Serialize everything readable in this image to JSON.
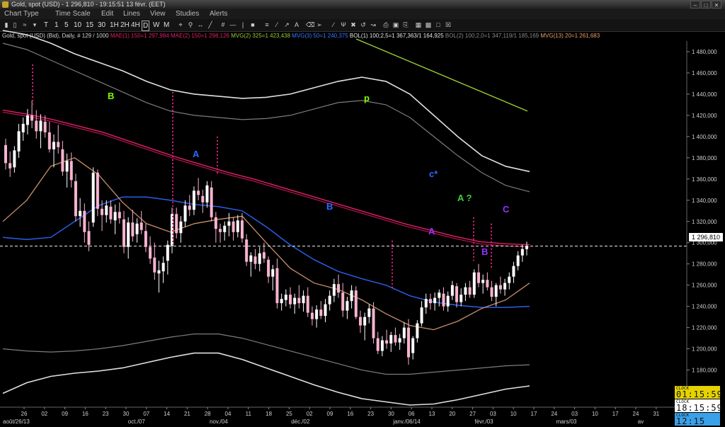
{
  "window": {
    "title": "Gold, spot (USD) - 1 296,810 - 19:15:51  13 févr. (EET)"
  },
  "menu": [
    "Chart Type",
    "Time Scale",
    "Edit",
    "Lines",
    "View",
    "Studies",
    "Alerts"
  ],
  "toolbar": {
    "timescales": [
      "T",
      "1",
      "5",
      "10",
      "15",
      "30",
      "1H",
      "2H",
      "4H",
      "D",
      "W",
      "M"
    ],
    "selected": "D"
  },
  "legend": [
    {
      "text": "Gold, spot (USD) (Bid), Daily, # 129 / 1000",
      "color": "#d8d8d8"
    },
    {
      "text": "MAE(1) 150=1 297,984",
      "color": "#e0206a"
    },
    {
      "text": "MAE(2) 150=1 298,126",
      "color": "#e0206a"
    },
    {
      "text": "MVG(2) 325=1 423,438",
      "color": "#9acd32"
    },
    {
      "text": "MVG(3) 50=1 240,375",
      "color": "#3a78ff"
    },
    {
      "text": "BOL(1) 100;2,5=1 367,363/1 164,925",
      "color": "#e8e8e8"
    },
    {
      "text": "BOL(2) 100;2,0=1 347,119/1 185,169",
      "color": "#8a8a8a"
    },
    {
      "text": "MVG(13) 20=1 261,683",
      "color": "#e8a060"
    }
  ],
  "annotations": [
    {
      "text": "B",
      "color": "#7fff00"
    },
    {
      "text": "p",
      "color": "#7fff00"
    },
    {
      "text": "A",
      "color": "#2a6aff"
    },
    {
      "text": "c*",
      "color": "#2a6aff"
    },
    {
      "text": "A ?",
      "color": "#3ed13e"
    },
    {
      "text": "B",
      "color": "#2a6aff"
    },
    {
      "text": "C",
      "color": "#9b30ff"
    },
    {
      "text": "A",
      "color": "#9b30ff"
    },
    {
      "text": "B",
      "color": "#9b30ff"
    }
  ],
  "price_label": "1 296,810",
  "clocks": [
    {
      "label": "CLOCK",
      "value": "01:15:59"
    },
    {
      "label": "CLOCK",
      "value": "18:15:59"
    },
    {
      "label": "CLOCK",
      "value": "12:15"
    }
  ],
  "chart_data": {
    "type": "candlestick",
    "title": "Gold, spot (USD) (Bid), Daily",
    "y_ticks": [
      1160,
      1180,
      1200,
      1220,
      1240,
      1260,
      1280,
      1300,
      1320,
      1340,
      1360,
      1380,
      1400,
      1420,
      1440,
      1460,
      1480
    ],
    "y_tick_labels": [
      "1 160,000",
      "1 180,000",
      "1 200,000",
      "1 220,000",
      "1 240,000",
      "1 260,000",
      "1 280,000",
      "1 300,000",
      "1 320,000",
      "1 340,000",
      "1 360,000",
      "1 380,000",
      "1 400,000",
      "1 420,000",
      "1 440,000",
      "1 460,000",
      "1 480,000"
    ],
    "last_price": 1296.81,
    "x_ticks": [
      "26",
      "02",
      "09",
      "16",
      "23",
      "30",
      "07",
      "14",
      "21",
      "28",
      "04",
      "11",
      "18",
      "25",
      "02",
      "09",
      "16",
      "23",
      "30",
      "06",
      "13",
      "20",
      "27",
      "03",
      "10",
      "17",
      "24",
      "03",
      "10",
      "17",
      "24",
      "31"
    ],
    "x_month_labels": [
      "août/26/13",
      "oct./07",
      "nov./04",
      "déc./02",
      "janv./06/14",
      "févr./03",
      "mars/03",
      "av"
    ],
    "candles": [
      [
        1392,
        1398,
        1369,
        1375
      ],
      [
        1375,
        1386,
        1362,
        1370
      ],
      [
        1371,
        1391,
        1366,
        1387
      ],
      [
        1386,
        1412,
        1380,
        1405
      ],
      [
        1404,
        1418,
        1396,
        1412
      ],
      [
        1411,
        1426,
        1402,
        1420
      ],
      [
        1420,
        1434,
        1408,
        1415
      ],
      [
        1415,
        1425,
        1398,
        1405
      ],
      [
        1405,
        1421,
        1389,
        1415
      ],
      [
        1414,
        1420,
        1399,
        1404
      ],
      [
        1404,
        1414,
        1385,
        1388
      ],
      [
        1388,
        1402,
        1371,
        1395
      ],
      [
        1395,
        1411,
        1384,
        1390
      ],
      [
        1388,
        1396,
        1363,
        1367
      ],
      [
        1367,
        1384,
        1352,
        1377
      ],
      [
        1377,
        1385,
        1352,
        1359
      ],
      [
        1358,
        1365,
        1320,
        1325
      ],
      [
        1325,
        1342,
        1315,
        1330
      ],
      [
        1330,
        1337,
        1300,
        1310
      ],
      [
        1311,
        1320,
        1292,
        1298
      ],
      [
        1319,
        1371,
        1315,
        1366
      ],
      [
        1366,
        1369,
        1325,
        1332
      ],
      [
        1332,
        1340,
        1311,
        1326
      ],
      [
        1326,
        1340,
        1319,
        1335
      ],
      [
        1334,
        1340,
        1318,
        1322
      ],
      [
        1321,
        1336,
        1308,
        1329
      ],
      [
        1329,
        1338,
        1318,
        1323
      ],
      [
        1322,
        1330,
        1290,
        1296
      ],
      [
        1296,
        1324,
        1285,
        1319
      ],
      [
        1319,
        1331,
        1301,
        1306
      ],
      [
        1308,
        1323,
        1300,
        1318
      ],
      [
        1319,
        1330,
        1308,
        1312
      ],
      [
        1311,
        1318,
        1291,
        1296
      ],
      [
        1296,
        1306,
        1280,
        1285
      ],
      [
        1286,
        1300,
        1265,
        1272
      ],
      [
        1271,
        1283,
        1253,
        1274
      ],
      [
        1273,
        1287,
        1262,
        1281
      ],
      [
        1283,
        1302,
        1270,
        1298
      ],
      [
        1297,
        1333,
        1290,
        1327
      ],
      [
        1327,
        1333,
        1304,
        1309
      ],
      [
        1309,
        1325,
        1300,
        1320
      ],
      [
        1320,
        1340,
        1315,
        1335
      ],
      [
        1335,
        1345,
        1325,
        1331
      ],
      [
        1331,
        1353,
        1326,
        1349
      ],
      [
        1349,
        1361,
        1340,
        1345
      ],
      [
        1344,
        1350,
        1328,
        1338
      ],
      [
        1338,
        1358,
        1333,
        1354
      ],
      [
        1352,
        1358,
        1320,
        1324
      ],
      [
        1324,
        1329,
        1300,
        1313
      ],
      [
        1313,
        1318,
        1300,
        1310
      ],
      [
        1310,
        1320,
        1302,
        1316
      ],
      [
        1316,
        1328,
        1306,
        1320
      ],
      [
        1320,
        1324,
        1302,
        1310
      ],
      [
        1310,
        1326,
        1305,
        1321
      ],
      [
        1321,
        1328,
        1300,
        1304
      ],
      [
        1303,
        1308,
        1278,
        1282
      ],
      [
        1282,
        1291,
        1268,
        1288
      ],
      [
        1287,
        1294,
        1275,
        1280
      ],
      [
        1280,
        1296,
        1273,
        1290
      ],
      [
        1291,
        1300,
        1281,
        1285
      ],
      [
        1284,
        1287,
        1262,
        1268
      ],
      [
        1268,
        1279,
        1255,
        1275
      ],
      [
        1276,
        1285,
        1238,
        1243
      ],
      [
        1243,
        1252,
        1236,
        1247
      ],
      [
        1246,
        1256,
        1240,
        1251
      ],
      [
        1251,
        1258,
        1238,
        1242
      ],
      [
        1242,
        1252,
        1233,
        1248
      ],
      [
        1248,
        1260,
        1238,
        1243
      ],
      [
        1243,
        1255,
        1235,
        1250
      ],
      [
        1250,
        1258,
        1230,
        1234
      ],
      [
        1234,
        1240,
        1222,
        1228
      ],
      [
        1228,
        1241,
        1220,
        1237
      ],
      [
        1237,
        1245,
        1228,
        1231
      ],
      [
        1231,
        1247,
        1225,
        1242
      ],
      [
        1242,
        1255,
        1236,
        1250
      ],
      [
        1250,
        1266,
        1244,
        1261
      ],
      [
        1261,
        1270,
        1248,
        1253
      ],
      [
        1253,
        1262,
        1230,
        1236
      ],
      [
        1236,
        1249,
        1228,
        1245
      ],
      [
        1245,
        1260,
        1238,
        1255
      ],
      [
        1255,
        1259,
        1228,
        1230
      ],
      [
        1230,
        1236,
        1215,
        1222
      ],
      [
        1222,
        1234,
        1208,
        1230
      ],
      [
        1230,
        1242,
        1224,
        1238
      ],
      [
        1238,
        1244,
        1205,
        1210
      ],
      [
        1210,
        1216,
        1195,
        1198
      ],
      [
        1198,
        1212,
        1193,
        1208
      ],
      [
        1208,
        1218,
        1200,
        1205
      ],
      [
        1205,
        1216,
        1197,
        1213
      ],
      [
        1213,
        1220,
        1203,
        1206
      ],
      [
        1206,
        1214,
        1199,
        1210
      ],
      [
        1210,
        1225,
        1205,
        1220
      ],
      [
        1220,
        1228,
        1185,
        1192
      ],
      [
        1196,
        1212,
        1190,
        1210
      ],
      [
        1210,
        1227,
        1206,
        1224
      ],
      [
        1224,
        1245,
        1221,
        1239
      ],
      [
        1239,
        1252,
        1233,
        1247
      ],
      [
        1247,
        1252,
        1237,
        1243
      ],
      [
        1243,
        1253,
        1236,
        1248
      ],
      [
        1248,
        1256,
        1240,
        1253
      ],
      [
        1252,
        1258,
        1236,
        1240
      ],
      [
        1240,
        1254,
        1235,
        1250
      ],
      [
        1250,
        1264,
        1246,
        1260
      ],
      [
        1259,
        1262,
        1239,
        1244
      ],
      [
        1244,
        1257,
        1240,
        1251
      ],
      [
        1251,
        1262,
        1245,
        1258
      ],
      [
        1258,
        1264,
        1248,
        1251
      ],
      [
        1251,
        1275,
        1248,
        1272
      ],
      [
        1272,
        1280,
        1258,
        1262
      ],
      [
        1262,
        1270,
        1252,
        1265
      ],
      [
        1265,
        1272,
        1255,
        1258
      ],
      [
        1258,
        1264,
        1245,
        1249
      ],
      [
        1249,
        1262,
        1240,
        1260
      ],
      [
        1260,
        1268,
        1252,
        1256
      ],
      [
        1256,
        1266,
        1250,
        1262
      ],
      [
        1262,
        1272,
        1256,
        1268
      ],
      [
        1268,
        1282,
        1262,
        1278
      ],
      [
        1278,
        1292,
        1274,
        1288
      ],
      [
        1288,
        1298,
        1282,
        1294
      ],
      [
        1294,
        1301,
        1288,
        1297
      ]
    ],
    "series": [
      {
        "name": "MAE(1) 150"
      },
      {
        "name": "MAE(2) 150"
      },
      {
        "name": "MVG(2) 325"
      },
      {
        "name": "MVG(3) 50"
      },
      {
        "name": "BOL(1) 100;2,5"
      },
      {
        "name": "BOL(2) 100;2,0"
      },
      {
        "name": "MVG(13) 20"
      }
    ]
  }
}
